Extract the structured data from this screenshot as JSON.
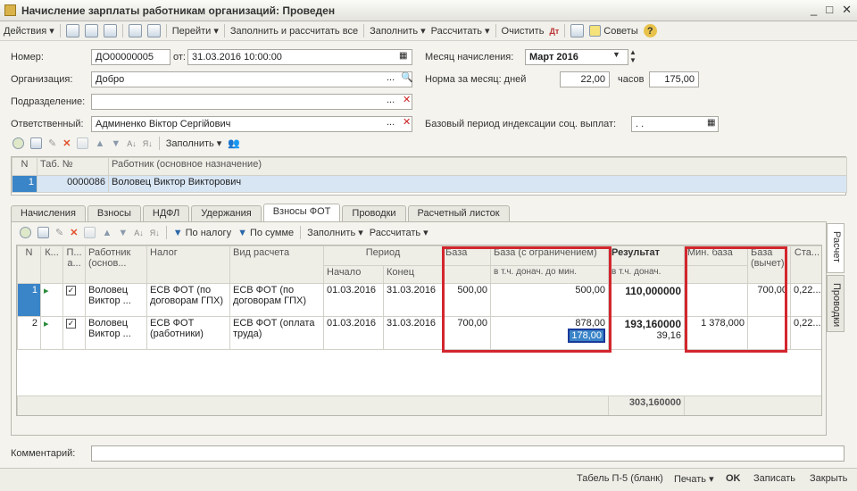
{
  "window": {
    "title": "Начисление зарплаты работникам организаций: Проведен"
  },
  "toolbar": {
    "actions": "Действия",
    "goto": "Перейти",
    "fill_calc_all": "Заполнить и рассчитать все",
    "fill": "Заполнить",
    "calculate": "Рассчитать",
    "clear": "Очистить",
    "tips": "Советы"
  },
  "form": {
    "number_label": "Номер:",
    "number": "ДО00000005",
    "from_label": "от:",
    "date": "31.03.2016 10:00:00",
    "org_label": "Организация:",
    "org": "Добро",
    "dept_label": "Подразделение:",
    "dept": "",
    "resp_label": "Ответственный:",
    "resp": "Админенко Віктор Сергійович",
    "month_label": "Месяц начисления:",
    "month": "Март 2016",
    "norm_label": "Норма за месяц: дней",
    "norm_days": "22,00",
    "hours_label": "часов",
    "norm_hours": "175,00",
    "base_period_label": "Базовый период индексации соц. выплат:",
    "base_period": ". ."
  },
  "workers": {
    "fill": "Заполнить",
    "headers": [
      "N",
      "Таб. №",
      "Работник (основное назначение)"
    ],
    "rows": [
      {
        "n": "1",
        "tab": "0000086",
        "name": "Воловец Виктор Викторович"
      }
    ]
  },
  "tabs": [
    "Начисления",
    "Взносы",
    "НДФЛ",
    "Удержания",
    "Взносы ФОТ",
    "Проводки",
    "Расчетный листок"
  ],
  "side_tabs": [
    "Расчет",
    "Проводки"
  ],
  "grid_toolbar": {
    "by_tax": "По налогу",
    "by_sum": "По сумме",
    "fill": "Заполнить",
    "calculate": "Рассчитать"
  },
  "grid": {
    "headers": {
      "n": "N",
      "k": "К...",
      "p": "П... а...",
      "worker": "Работник (основ...",
      "tax": "Налог",
      "calc_type": "Вид расчета",
      "period": "Период",
      "start": "Начало",
      "end": "Конец",
      "base": "База",
      "base_limit": "База (с ограничением)",
      "incl_extra": "в т.ч. донач. до мин.",
      "result": "Результат",
      "result_extra": "в т.ч. донач.",
      "min_base": "Мин. база",
      "base_deduct": "База (вычет)",
      "rate": "Ста..."
    },
    "rows": [
      {
        "n": "1",
        "worker": "Воловец Виктор ...",
        "tax": "ЕСВ ФОТ (по договорам ГПХ)",
        "calc_type": "ЕСВ ФОТ (по договорам ГПХ)",
        "start": "01.03.2016",
        "end": "31.03.2016",
        "base": "500,00",
        "base_limit": "500,00",
        "extra": "",
        "result": "110,000000",
        "result_extra": "",
        "min_base": "",
        "base_deduct": "700,00",
        "rate": "0,22..."
      },
      {
        "n": "2",
        "worker": "Воловец Виктор ...",
        "tax": "ЕСВ ФОТ (работники)",
        "calc_type": "ЕСВ ФОТ (оплата труда)",
        "start": "01.03.2016",
        "end": "31.03.2016",
        "base": "700,00",
        "base_limit": "878,00",
        "extra": "178,00",
        "result": "193,160000",
        "result_extra": "39,16",
        "min_base": "1 378,000",
        "base_deduct": "",
        "rate": "0,22..."
      }
    ],
    "total": "303,160000"
  },
  "comment_label": "Комментарий:",
  "bottom": {
    "table": "Табель П-5 (бланк)",
    "print": "Печать",
    "ok": "OK",
    "save": "Записать",
    "close": "Закрыть"
  }
}
